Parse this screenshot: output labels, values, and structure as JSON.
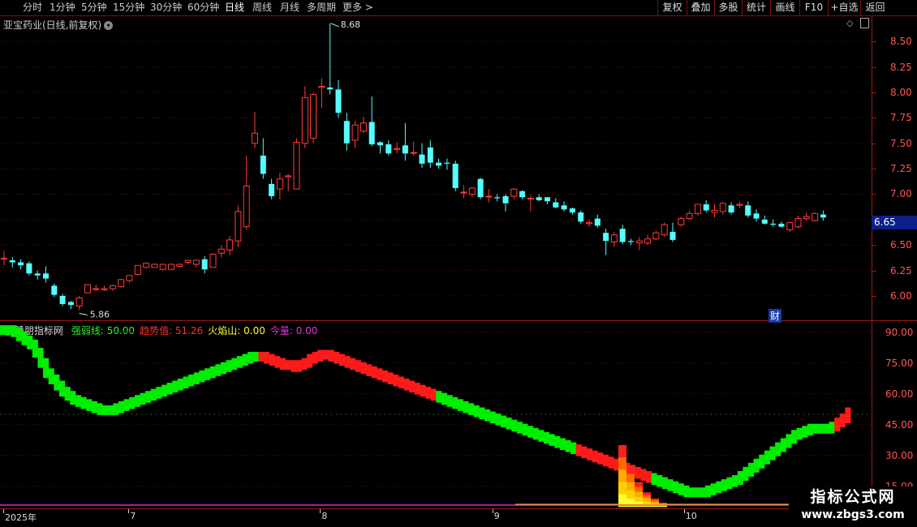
{
  "toolbar": {
    "periods": [
      "分时",
      "1分钟",
      "5分钟",
      "15分钟",
      "30分钟",
      "60分钟",
      "日线",
      "周线",
      "月线",
      "多周期",
      "更多 >"
    ],
    "active_period": "日线",
    "right_buttons": [
      "复权",
      "叠加",
      "多股",
      "统计",
      "画线",
      "F10",
      "+自选",
      "返回"
    ]
  },
  "chart_title": "亚宝药业(日线,前复权)",
  "chart_title_icon": "chevron-down-icon",
  "indicator": {
    "name": "股朋指标网",
    "items": [
      {
        "label": "强弱线: 50.00",
        "color": "#33ee33"
      },
      {
        "label": "趋势值: 51.26",
        "color": "#ff3030"
      },
      {
        "label": "火焰山: 0.00",
        "color": "#ffff33"
      },
      {
        "label": "今量: 0.00",
        "color": "#dd33dd"
      }
    ]
  },
  "current_price": "6.65",
  "finance_badge": "财",
  "annotations": {
    "high": "8.68",
    "low": "5.86"
  },
  "price_axis": [
    "8.50",
    "8.25",
    "8.00",
    "7.75",
    "7.50",
    "7.25",
    "7.00",
    "6.75",
    "6.50",
    "6.25",
    "6.00"
  ],
  "indi_axis": [
    "90.00",
    "75.00",
    "60.00",
    "45.00",
    "30.00",
    "15.00"
  ],
  "dates": [
    {
      "label": "2025年",
      "idx": 0
    },
    {
      "label": "7",
      "idx": 13
    },
    {
      "label": "8",
      "idx": 33
    },
    {
      "label": "9",
      "idx": 51
    },
    {
      "label": "10",
      "idx": 71
    }
  ],
  "watermark": {
    "title": "指标公式网",
    "url": "www.zbgs3.com"
  },
  "colors": {
    "up": "#ff3b3b",
    "down": "#54ffff",
    "strong": "#00ee00",
    "trend": "#ff1a1a"
  },
  "chart_data": [
    {
      "type": "candlestick",
      "ylim": [
        5.8,
        8.75
      ],
      "candles": [
        [
          6.37,
          6.37,
          6.44,
          6.3
        ],
        [
          6.35,
          6.33,
          6.38,
          6.28
        ],
        [
          6.33,
          6.3,
          6.36,
          6.26
        ],
        [
          6.32,
          6.22,
          6.34,
          6.2
        ],
        [
          6.22,
          6.2,
          6.25,
          6.16
        ],
        [
          6.22,
          6.17,
          6.29,
          6.13
        ],
        [
          6.1,
          6.01,
          6.12,
          5.99
        ],
        [
          6.0,
          5.92,
          6.02,
          5.9
        ],
        [
          5.94,
          5.91,
          5.95,
          5.87
        ],
        [
          5.9,
          5.98,
          6.0,
          5.86
        ],
        [
          6.03,
          6.11,
          6.11,
          6.03
        ],
        [
          6.07,
          6.07,
          6.11,
          6.05
        ],
        [
          6.06,
          6.07,
          6.1,
          6.05
        ],
        [
          6.07,
          6.1,
          6.11,
          6.05
        ],
        [
          6.09,
          6.16,
          6.17,
          6.08
        ],
        [
          6.15,
          6.2,
          6.2,
          6.13
        ],
        [
          6.21,
          6.3,
          6.3,
          6.2
        ],
        [
          6.28,
          6.32,
          6.33,
          6.27
        ],
        [
          6.28,
          6.31,
          6.32,
          6.28
        ],
        [
          6.26,
          6.31,
          6.31,
          6.25
        ],
        [
          6.26,
          6.31,
          6.32,
          6.26
        ],
        [
          6.29,
          6.31,
          6.32,
          6.28
        ],
        [
          6.33,
          6.35,
          6.35,
          6.31
        ],
        [
          6.31,
          6.35,
          6.35,
          6.28
        ],
        [
          6.36,
          6.26,
          6.39,
          6.22
        ],
        [
          6.28,
          6.41,
          6.42,
          6.28
        ],
        [
          6.42,
          6.46,
          6.5,
          6.38
        ],
        [
          6.45,
          6.55,
          6.59,
          6.4
        ],
        [
          6.54,
          6.83,
          6.89,
          6.48
        ],
        [
          6.68,
          7.08,
          7.38,
          6.65
        ],
        [
          7.5,
          7.6,
          7.81,
          7.45
        ],
        [
          7.38,
          7.2,
          7.55,
          7.15
        ],
        [
          7.1,
          6.98,
          7.15,
          6.95
        ],
        [
          7.05,
          7.15,
          7.21,
          6.95
        ],
        [
          7.17,
          7.18,
          7.2,
          7.03
        ],
        [
          7.05,
          7.51,
          7.55,
          7.05
        ],
        [
          7.5,
          7.95,
          8.06,
          7.45
        ],
        [
          7.55,
          7.98,
          8.0,
          7.5
        ],
        [
          8.05,
          8.06,
          8.14,
          7.85
        ],
        [
          8.05,
          8.03,
          8.68,
          7.98
        ],
        [
          8.03,
          7.8,
          8.12,
          7.75
        ],
        [
          7.72,
          7.5,
          7.8,
          7.43
        ],
        [
          7.53,
          7.68,
          7.72,
          7.45
        ],
        [
          7.62,
          7.7,
          7.76,
          7.6
        ],
        [
          7.71,
          7.49,
          7.96,
          7.47
        ],
        [
          7.51,
          7.48,
          7.52,
          7.4
        ],
        [
          7.49,
          7.4,
          7.53,
          7.38
        ],
        [
          7.44,
          7.45,
          7.51,
          7.4
        ],
        [
          7.48,
          7.4,
          7.7,
          7.33
        ],
        [
          7.41,
          7.41,
          7.52,
          7.38
        ],
        [
          7.39,
          7.3,
          7.5,
          7.26
        ],
        [
          7.46,
          7.31,
          7.53,
          7.26
        ],
        [
          7.31,
          7.28,
          7.35,
          7.25
        ],
        [
          7.31,
          7.3,
          7.35,
          7.24
        ],
        [
          7.3,
          7.06,
          7.33,
          7.03
        ],
        [
          7.02,
          7.02,
          7.09,
          6.96
        ],
        [
          7.0,
          7.06,
          7.07,
          6.97
        ],
        [
          7.15,
          6.97,
          7.16,
          6.95
        ],
        [
          6.98,
          6.98,
          7.05,
          6.92
        ],
        [
          6.97,
          6.96,
          7.0,
          6.93
        ],
        [
          6.98,
          6.91,
          7.0,
          6.83
        ],
        [
          6.98,
          7.05,
          7.06,
          6.95
        ],
        [
          7.03,
          6.97,
          7.04,
          6.95
        ],
        [
          6.96,
          6.96,
          6.99,
          6.83
        ],
        [
          6.97,
          6.94,
          7.0,
          6.93
        ],
        [
          6.97,
          6.93,
          6.97,
          6.9
        ],
        [
          6.92,
          6.87,
          6.96,
          6.86
        ],
        [
          6.89,
          6.85,
          6.93,
          6.83
        ],
        [
          6.86,
          6.82,
          6.87,
          6.8
        ],
        [
          6.82,
          6.73,
          6.84,
          6.71
        ],
        [
          6.71,
          6.72,
          6.75,
          6.68
        ],
        [
          6.76,
          6.69,
          6.8,
          6.67
        ],
        [
          6.62,
          6.54,
          6.66,
          6.4
        ],
        [
          6.53,
          6.6,
          6.63,
          6.48
        ],
        [
          6.66,
          6.53,
          6.7,
          6.51
        ],
        [
          6.54,
          6.53,
          6.56,
          6.5
        ],
        [
          6.52,
          6.54,
          6.58,
          6.45
        ],
        [
          6.52,
          6.56,
          6.6,
          6.5
        ],
        [
          6.56,
          6.62,
          6.64,
          6.55
        ],
        [
          6.6,
          6.7,
          6.72,
          6.58
        ],
        [
          6.63,
          6.55,
          6.72,
          6.53
        ],
        [
          6.7,
          6.76,
          6.78,
          6.68
        ],
        [
          6.76,
          6.81,
          6.84,
          6.75
        ],
        [
          6.81,
          6.9,
          6.9,
          6.79
        ],
        [
          6.9,
          6.84,
          6.94,
          6.82
        ],
        [
          6.82,
          6.84,
          6.9,
          6.77
        ],
        [
          6.83,
          6.91,
          6.92,
          6.8
        ],
        [
          6.89,
          6.82,
          6.92,
          6.8
        ],
        [
          6.89,
          6.9,
          6.92,
          6.86
        ],
        [
          6.89,
          6.79,
          6.93,
          6.77
        ],
        [
          6.81,
          6.76,
          6.85,
          6.73
        ],
        [
          6.75,
          6.71,
          6.79,
          6.7
        ],
        [
          6.71,
          6.7,
          6.75,
          6.68
        ],
        [
          6.71,
          6.68,
          6.73,
          6.67
        ],
        [
          6.65,
          6.72,
          6.73,
          6.63
        ],
        [
          6.68,
          6.76,
          6.79,
          6.66
        ],
        [
          6.76,
          6.78,
          6.82,
          6.74
        ],
        [
          6.74,
          6.81,
          6.82,
          6.73
        ],
        [
          6.8,
          6.77,
          6.84,
          6.74
        ]
      ]
    },
    {
      "type": "area",
      "ylim": [
        5,
        95
      ],
      "midline": 50,
      "trend_values": [
        91,
        91,
        90,
        88,
        86,
        84,
        80,
        75,
        70,
        67,
        64,
        61,
        59,
        57,
        56,
        55,
        54,
        53,
        52,
        52,
        52,
        53,
        54,
        55,
        56,
        57,
        58,
        59,
        60,
        61,
        62,
        63,
        64,
        65,
        66,
        67,
        68,
        69,
        70,
        71,
        72,
        73,
        74,
        75,
        76,
        77,
        78,
        78,
        78,
        77,
        76,
        75,
        74,
        74,
        73,
        74,
        75,
        77,
        78,
        79,
        79,
        78,
        77,
        76,
        75,
        74,
        73,
        72,
        71,
        70,
        69,
        68,
        67,
        66,
        65,
        64,
        63,
        62,
        61,
        60,
        59,
        58,
        57,
        56,
        55,
        54,
        53,
        52,
        51,
        50,
        49,
        48,
        47,
        46,
        45,
        44,
        43,
        42,
        41,
        40,
        39,
        38,
        37,
        36,
        35,
        34,
        33,
        32,
        31,
        30,
        29,
        28,
        27,
        26,
        25,
        24,
        23,
        22,
        21,
        20,
        19,
        18,
        17,
        16,
        15,
        14,
        13,
        12,
        12,
        12,
        12,
        13,
        14,
        15,
        16,
        17,
        18,
        20,
        22,
        24,
        26,
        28,
        30,
        32,
        34,
        36,
        38,
        40,
        41,
        42,
        43,
        43,
        43,
        43,
        44,
        46,
        48,
        51
      ],
      "trend_up_ranges": [
        [
          48,
          80
        ],
        [
          107,
          120
        ],
        [
          155,
          175
        ],
        [
          181,
          198
        ]
      ],
      "flame": [
        [
          0,
          30
        ],
        [
          1,
          20
        ],
        [
          2,
          12
        ],
        [
          3,
          7
        ],
        [
          4,
          4
        ],
        [
          5,
          2
        ]
      ]
    }
  ]
}
